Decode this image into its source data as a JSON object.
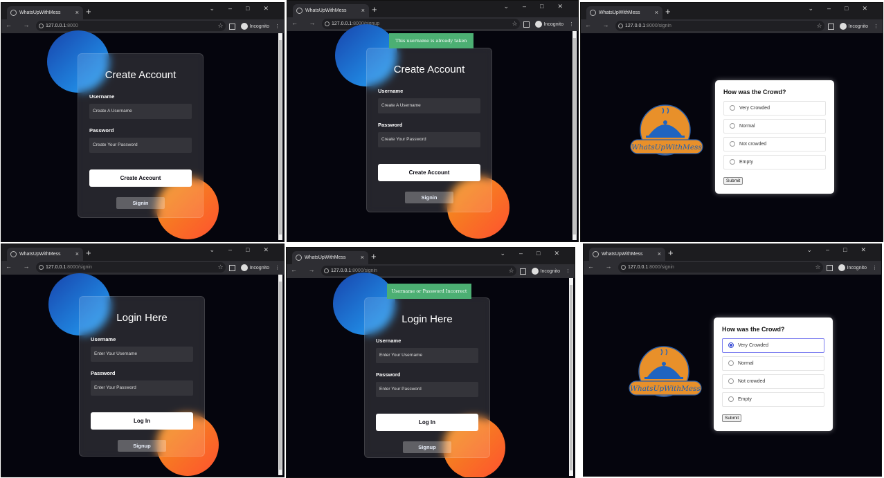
{
  "browser": {
    "tab_title": "WhatsUpWithMess",
    "new_tab": "+",
    "tab_close": "×",
    "win_controls": [
      "⌄",
      "–",
      "□",
      "✕"
    ],
    "nav_glyphs": "← → C",
    "host": "127.0.0.1",
    "port_signin": ":8000/signin",
    "port_signup": ":8000/signup",
    "port_root": ":8000",
    "incognito_label": "Incognito",
    "star": "☆",
    "more": "⋮"
  },
  "signup": {
    "title": "Create Account",
    "username_label": "Username",
    "username_placeholder": "Create A Username",
    "password_label": "Password",
    "password_placeholder": "Create Your Password",
    "submit_label": "Create Account",
    "alt_label": "Signin",
    "toast": "This username is already taken"
  },
  "login": {
    "title": "Login Here",
    "username_label": "Username",
    "username_placeholder": "Enter Your Username",
    "password_label": "Password",
    "password_placeholder": "Enter Your Password",
    "submit_label": "Log In",
    "alt_label": "Signup",
    "toast": "Username or Password Incorrect"
  },
  "crowd": {
    "title": "How was the Crowd?",
    "options": [
      "Very Crowded",
      "Normal",
      "Not crowded",
      "Empty"
    ],
    "selected_index_panel6": 0,
    "submit_label": "Submit"
  },
  "logo": {
    "text": "WhatsUpWithMess",
    "colors": {
      "orange": "#e8902a",
      "blue": "#1d5fb6",
      "cloche": "#1f64c0"
    }
  }
}
